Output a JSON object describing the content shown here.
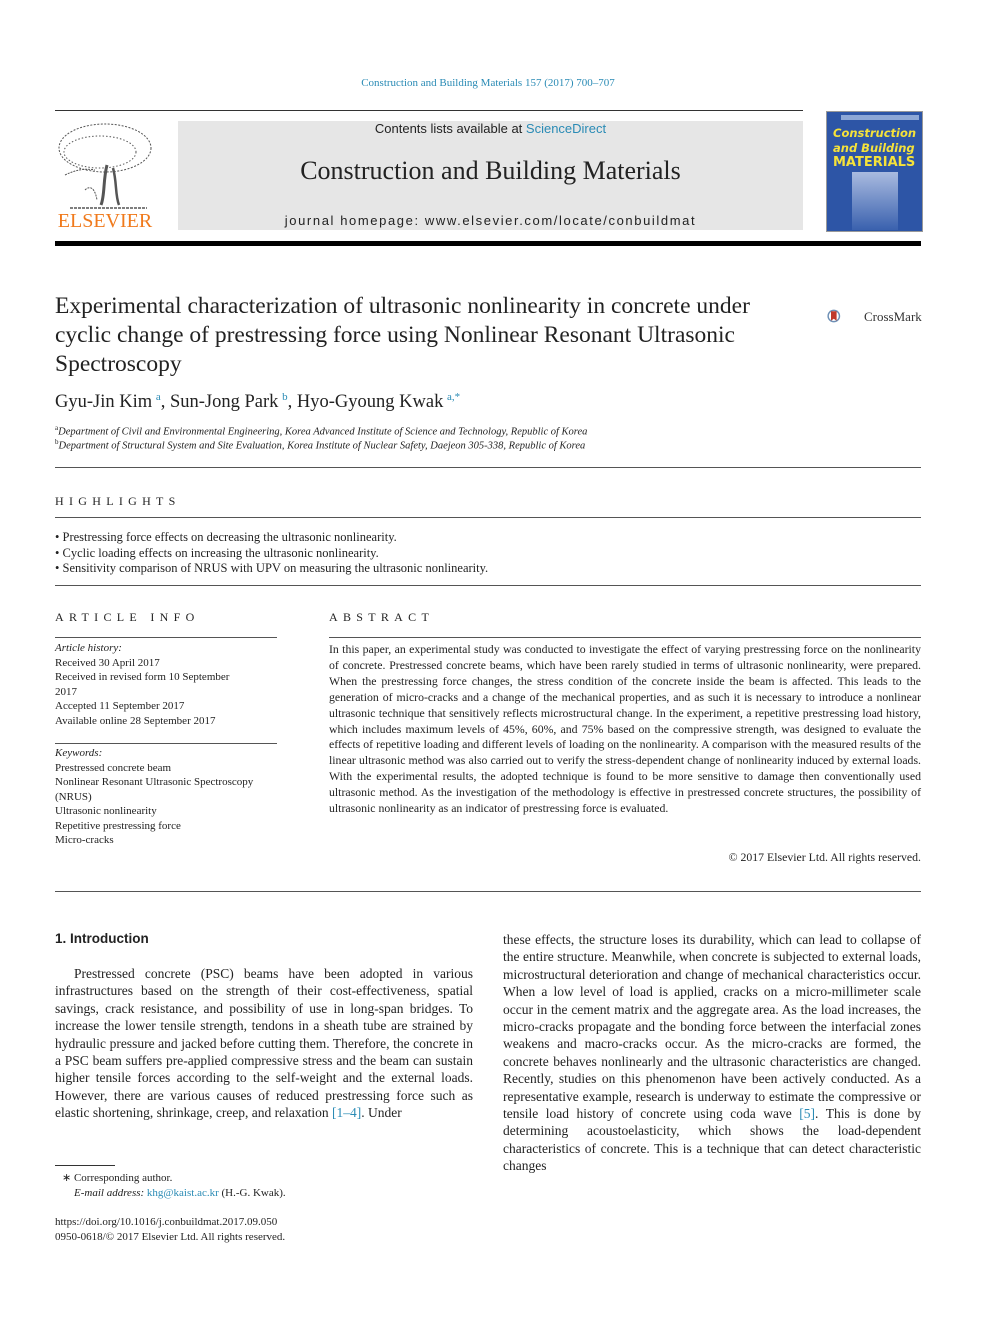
{
  "header": {
    "journal_ref": "Construction and Building Materials 157 (2017) 700–707",
    "publisher_logo_text": "ELSEVIER",
    "contents_prefix": "Contents lists available at ",
    "contents_link": "ScienceDirect",
    "journal_title": "Construction and Building Materials",
    "homepage_label": "journal homepage: www.elsevier.com/locate/conbuildmat",
    "cover": {
      "line1": "Construction",
      "line2": "and Building",
      "line3": "MATERIALS"
    },
    "colors": {
      "link": "#2a8bb5",
      "elsevier_orange": "#f07a1c",
      "cover_blue": "#2d55a6",
      "cover_yellow": "#f5e23a"
    }
  },
  "article": {
    "title": "Experimental characterization of ultrasonic nonlinearity in concrete under cyclic change of prestressing force using Nonlinear Resonant Ultrasonic Spectroscopy",
    "crossmark_label": "CrossMark",
    "authors": [
      {
        "name": "Gyu-Jin Kim",
        "sup": "a"
      },
      {
        "name": "Sun-Jong Park",
        "sup": "b"
      },
      {
        "name": "Hyo-Gyoung Kwak",
        "sup": "a,*"
      }
    ],
    "affiliations": [
      {
        "mark": "a",
        "text": "Department of Civil and Environmental Engineering, Korea Advanced Institute of Science and Technology, Republic of Korea"
      },
      {
        "mark": "b",
        "text": "Department of Structural System and Site Evaluation, Korea Institute of Nuclear Safety, Daejeon 305-338, Republic of Korea"
      }
    ]
  },
  "highlights": {
    "heading": "HIGHLIGHTS",
    "items": [
      "Prestressing force effects on decreasing the ultrasonic nonlinearity.",
      "Cyclic loading effects on increasing the ultrasonic nonlinearity.",
      "Sensitivity comparison of NRUS with UPV on measuring the ultrasonic nonlinearity."
    ]
  },
  "article_info": {
    "heading": "ARTICLE INFO",
    "history_label": "Article history:",
    "history": [
      "Received 30 April 2017",
      "Received in revised form 10 September",
      "2017",
      "Accepted 11 September 2017",
      "Available online 28 September 2017"
    ],
    "keywords_label": "Keywords:",
    "keywords": [
      "Prestressed concrete beam",
      "Nonlinear Resonant Ultrasonic Spectroscopy",
      "(NRUS)",
      "Ultrasonic nonlinearity",
      "Repetitive prestressing force",
      "Micro-cracks"
    ]
  },
  "abstract": {
    "heading": "ABSTRACT",
    "text": "In this paper, an experimental study was conducted to investigate the effect of varying prestressing force on the nonlinearity of concrete. Prestressed concrete beams, which have been rarely studied in terms of ultrasonic nonlinearity, were prepared. When the prestressing force changes, the stress condition of the concrete inside the beam is affected. This leads to the generation of micro-cracks and a change of the mechanical properties, and as such it is necessary to introduce a nonlinear ultrasonic technique that sensitively reflects microstructural change. In the experiment, a repetitive prestressing load history, which includes maximum levels of 45%, 60%, and 75% based on the compressive strength, was designed to evaluate the effects of repetitive loading and different levels of loading on the nonlinearity. A comparison with the measured results of the linear ultrasonic method was also carried out to verify the stress-dependent change of nonlinearity induced by external loads. With the experimental results, the adopted technique is found to be more sensitive to damage then conventionally used ultrasonic method. As the investigation of the methodology is effective in prestressed concrete structures, the possibility of ultrasonic nonlinearity as an indicator of prestressing force is evaluated.",
    "copyright": "© 2017 Elsevier Ltd. All rights reserved."
  },
  "introduction": {
    "heading": "1. Introduction",
    "left_before_ref": "Prestressed concrete (PSC) beams have been adopted in various infrastructures based on the strength of their cost-effectiveness, spatial savings, crack resistance, and possibility of use in long-span bridges. To increase the lower tensile strength, tendons in a sheath tube are strained by hydraulic pressure and jacked before cutting them. Therefore, the concrete in a PSC beam suffers pre-applied compressive stress and the beam can sustain higher tensile forces according to the self-weight and the external loads. However, there are various causes of reduced prestressing force such as elastic shortening, shrinkage, creep, and relaxation ",
    "left_ref": "[1–4]",
    "left_after_ref": ". Under",
    "right_before_ref": "these effects, the structure loses its durability, which can lead to collapse of the entire structure. Meanwhile, when concrete is subjected to external loads, microstructural deterioration and change of mechanical characteristics occur. When a low level of load is applied, cracks on a micro-millimeter scale occur in the cement matrix and the aggregate area. As the load increases, the micro-cracks propagate and the bonding force between the interfacial zones weakens and macro-cracks occur. As the micro-cracks are formed, the concrete behaves nonlinearly and the ultrasonic characteristics are changed. Recently, studies on this phenomenon have been actively conducted. As a representative example, research is underway to estimate the compressive or tensile load history of concrete using coda wave ",
    "right_ref": "[5]",
    "right_after_ref": ". This is done by determining acoustoelasticity, which shows the load-dependent characteristics of concrete. This is a technique that can detect characteristic changes"
  },
  "footnotes": {
    "corresponding": "∗ Corresponding author.",
    "email_label": "E-mail address: ",
    "email": "khg@kaist.ac.kr",
    "email_suffix": " (H.-G. Kwak).",
    "doi": "https://doi.org/10.1016/j.conbuildmat.2017.09.050",
    "issn": "0950-0618/© 2017 Elsevier Ltd. All rights reserved."
  }
}
